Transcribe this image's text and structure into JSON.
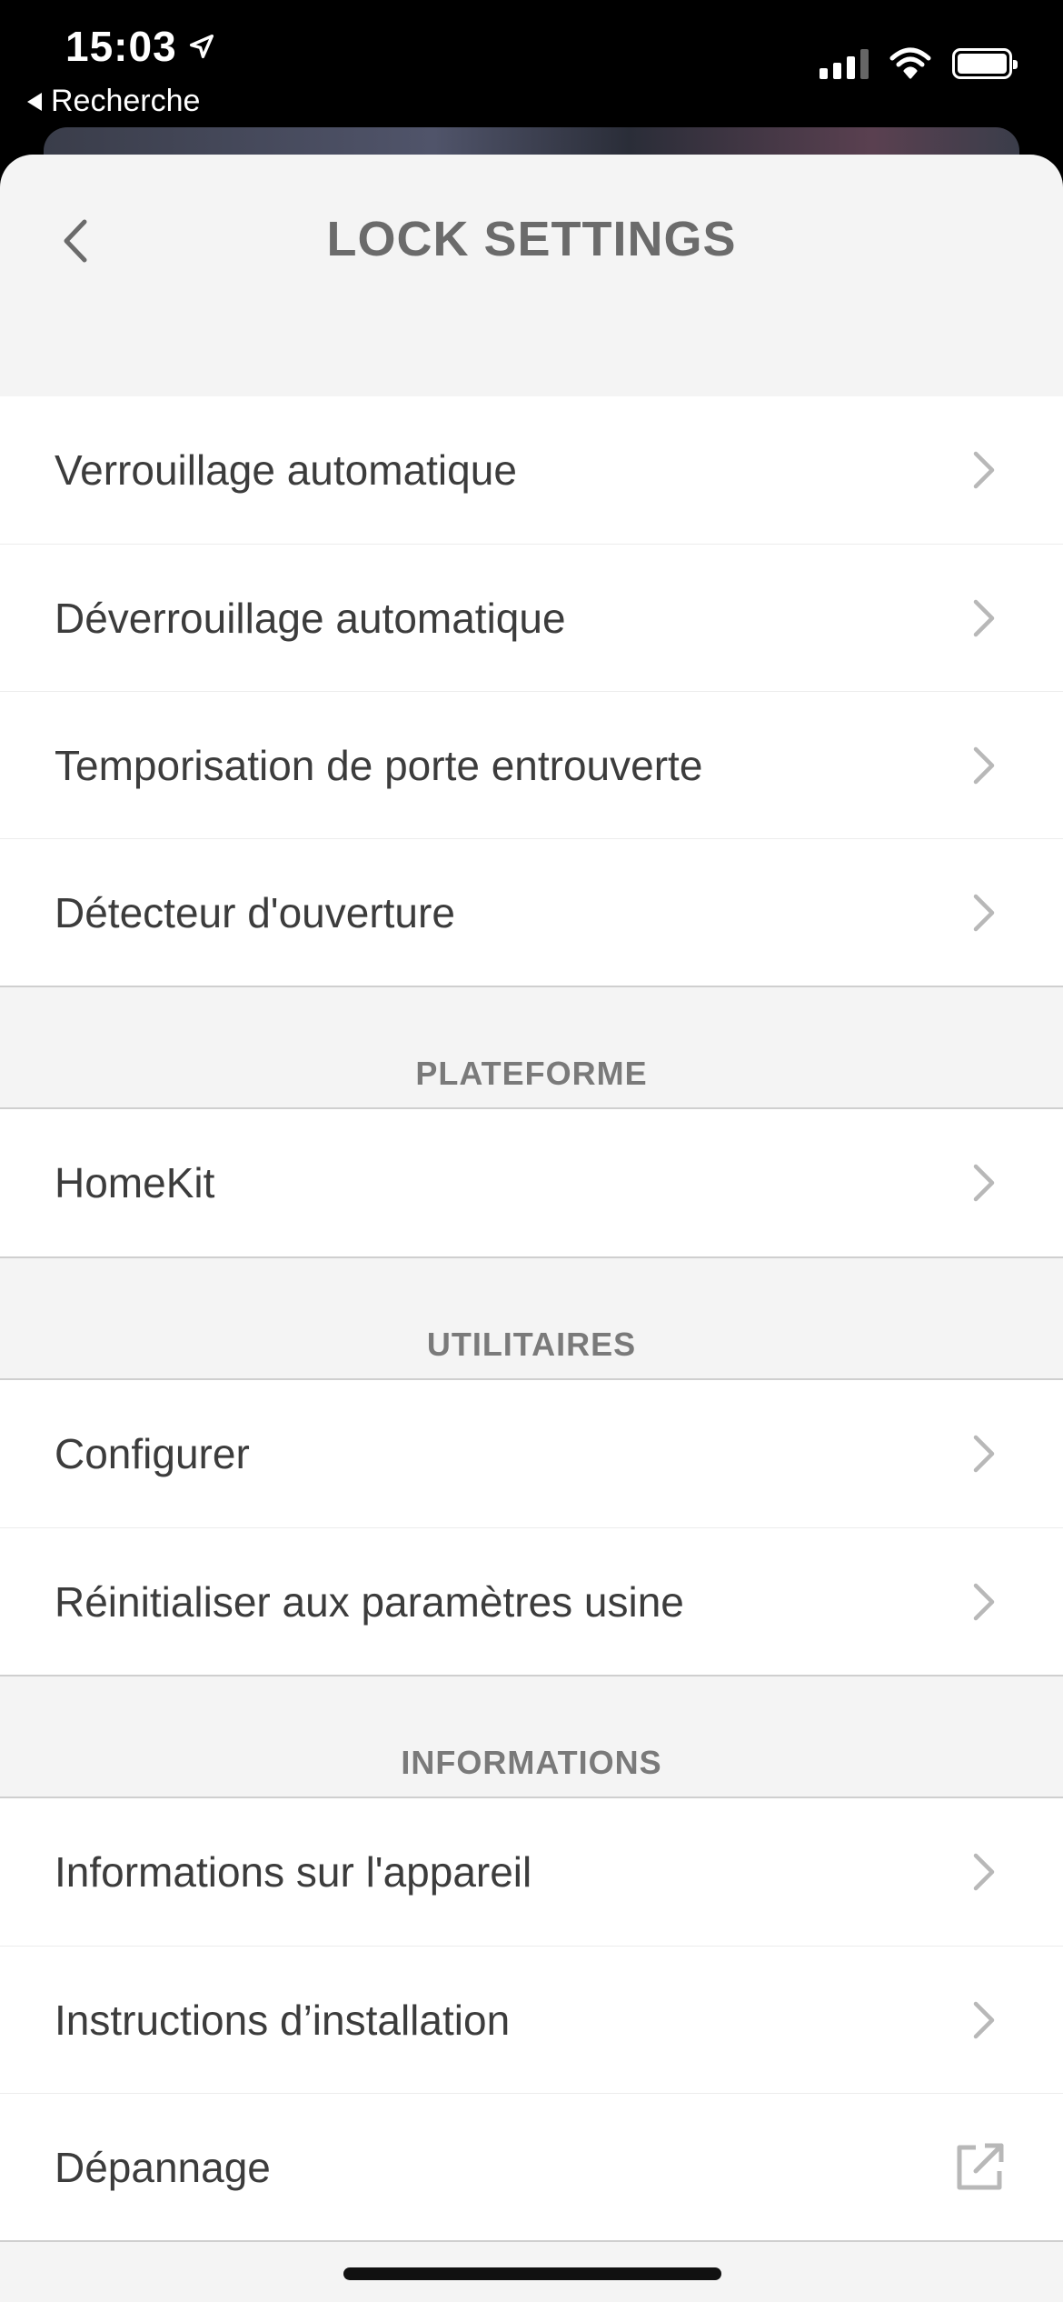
{
  "status_bar": {
    "time": "15:03",
    "back_app_label": "Recherche"
  },
  "header": {
    "title": "LOCK SETTINGS"
  },
  "groups": [
    {
      "header": "",
      "items": [
        {
          "label": "Verrouillage automatique",
          "icon": "chevron-right-icon"
        },
        {
          "label": "Déverrouillage automatique",
          "icon": "chevron-right-icon"
        },
        {
          "label": "Temporisation de porte entrouverte",
          "icon": "chevron-right-icon"
        },
        {
          "label": "Détecteur d'ouverture",
          "icon": "chevron-right-icon"
        }
      ]
    },
    {
      "header": "PLATEFORME",
      "items": [
        {
          "label": "HomeKit",
          "icon": "chevron-right-icon"
        }
      ]
    },
    {
      "header": "UTILITAIRES",
      "items": [
        {
          "label": "Configurer",
          "icon": "chevron-right-icon"
        },
        {
          "label": "Réinitialiser aux paramètres usine",
          "icon": "chevron-right-icon"
        }
      ]
    },
    {
      "header": "INFORMATIONS",
      "items": [
        {
          "label": "Informations sur l'appareil",
          "icon": "chevron-right-icon"
        },
        {
          "label": "Instructions d’installation",
          "icon": "chevron-right-icon"
        },
        {
          "label": "Dépannage",
          "icon": "external-link-icon"
        }
      ]
    }
  ],
  "colors": {
    "sheet_background": "#f4f4f4",
    "row_background": "#ffffff",
    "text": "#3c3c3c",
    "title": "#6b6b6b",
    "section_header": "#7a7a7a",
    "chevron": "#b8b8b8"
  }
}
